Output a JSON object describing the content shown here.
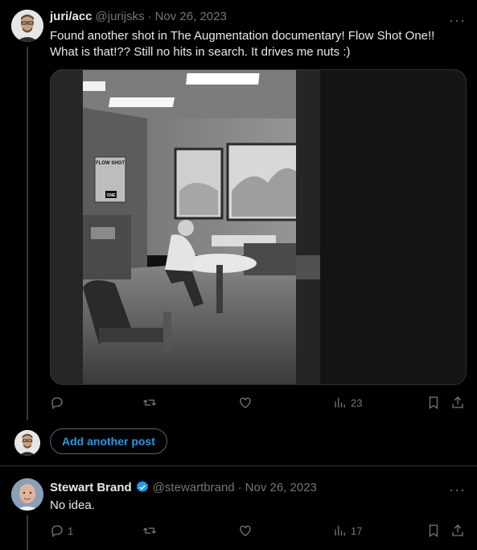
{
  "tweet1": {
    "name": "juri/acc",
    "handle": "@jurijsks",
    "sep": "·",
    "date": "Nov 26, 2023",
    "text_line1": "Found another shot in The Augmentation documentary! Flow Shot One!!",
    "text_line2": "What is that!?? Still no hits in search. It drives me nuts :)",
    "media_sign_line1": "FLOW SHOT",
    "media_sign_line2": "ONE",
    "views": "23",
    "more": "···"
  },
  "compose": {
    "add_another_post": "Add another post"
  },
  "tweet2": {
    "name": "Stewart Brand",
    "handle": "@stewartbrand",
    "sep": "·",
    "date": "Nov 26, 2023",
    "text": "No idea.",
    "replies": "1",
    "views": "17",
    "more": "···"
  },
  "colors": {
    "background": "#000000",
    "text": "#e7e9ea",
    "muted": "#71767b",
    "accent": "#1d9bf0",
    "border": "#2f3336"
  }
}
